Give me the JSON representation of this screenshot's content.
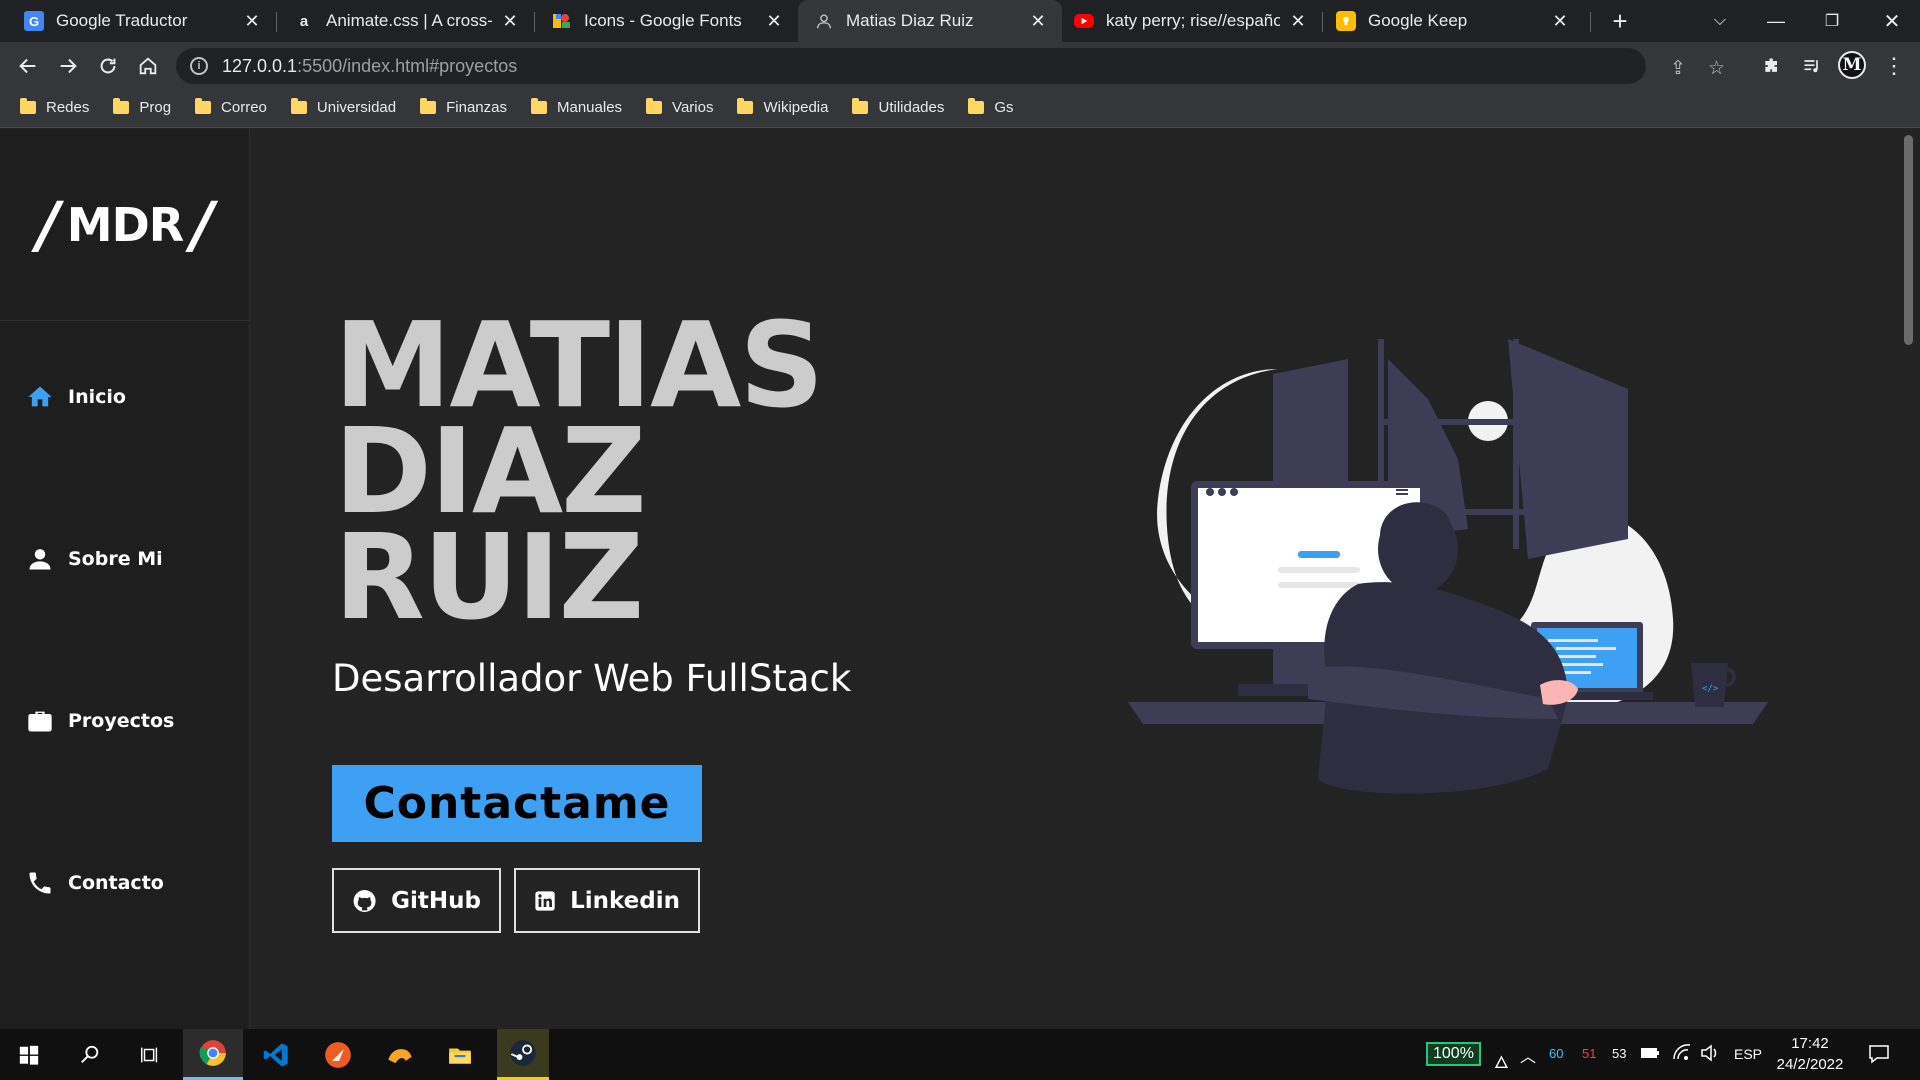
{
  "browser": {
    "tabs": [
      {
        "title": "Google Traductor",
        "favicon": "google-translate-icon",
        "active": false
      },
      {
        "title": "Animate.css | A cross-brow",
        "favicon": "animate-css-icon",
        "active": false
      },
      {
        "title": "Icons - Google Fonts",
        "favicon": "google-fonts-icon",
        "active": false
      },
      {
        "title": "Matias Diaz Ruiz",
        "favicon": "page-icon",
        "active": true
      },
      {
        "title": "katy perry; rise//español - Y",
        "favicon": "youtube-icon",
        "active": false
      },
      {
        "title": "Google Keep",
        "favicon": "google-keep-icon",
        "active": false
      }
    ],
    "address": {
      "host": "127.0.0.1",
      "path": ":5500/index.html#proyectos"
    },
    "profile_initial": "M",
    "bookmarks": [
      "Redes",
      "Prog",
      "Correo",
      "Universidad",
      "Finanzas",
      "Manuales",
      "Varios",
      "Wikipedia",
      "Utilidades",
      "Gs"
    ]
  },
  "site": {
    "logo": {
      "slash_left": "/",
      "text": "MDR",
      "slash_right": "/"
    },
    "nav": [
      {
        "label": "Inicio",
        "icon": "home-icon",
        "color": "#3ea0f2"
      },
      {
        "label": "Sobre Mi",
        "icon": "person-icon",
        "color": "#ffffff"
      },
      {
        "label": "Proyectos",
        "icon": "briefcase-icon",
        "color": "#ffffff"
      },
      {
        "label": "Contacto",
        "icon": "phone-icon",
        "color": "#ffffff"
      }
    ],
    "hero": {
      "name_lines": [
        "MATIAS",
        "DIAZ",
        "RUIZ"
      ],
      "subtitle": "Desarrollador Web FullStack",
      "cta": "Contactame",
      "github": "GitHub",
      "linkedin": "Linkedin"
    },
    "colors": {
      "accent": "#3ea0f2",
      "background": "#232323",
      "sidebar": "#1e1e1e",
      "name": "#cccccc"
    }
  },
  "taskbar": {
    "apps": [
      "windows-start-icon",
      "search-icon",
      "task-view-icon",
      "chrome-icon",
      "vscode-icon",
      "postman-icon",
      "sandbox-icon",
      "file-explorer-icon",
      "steam-icon"
    ],
    "battery": "100%",
    "tray_numbers": [
      "60",
      "51",
      "53"
    ],
    "language": "ESP",
    "time": "17:42",
    "date": "24/2/2022"
  }
}
